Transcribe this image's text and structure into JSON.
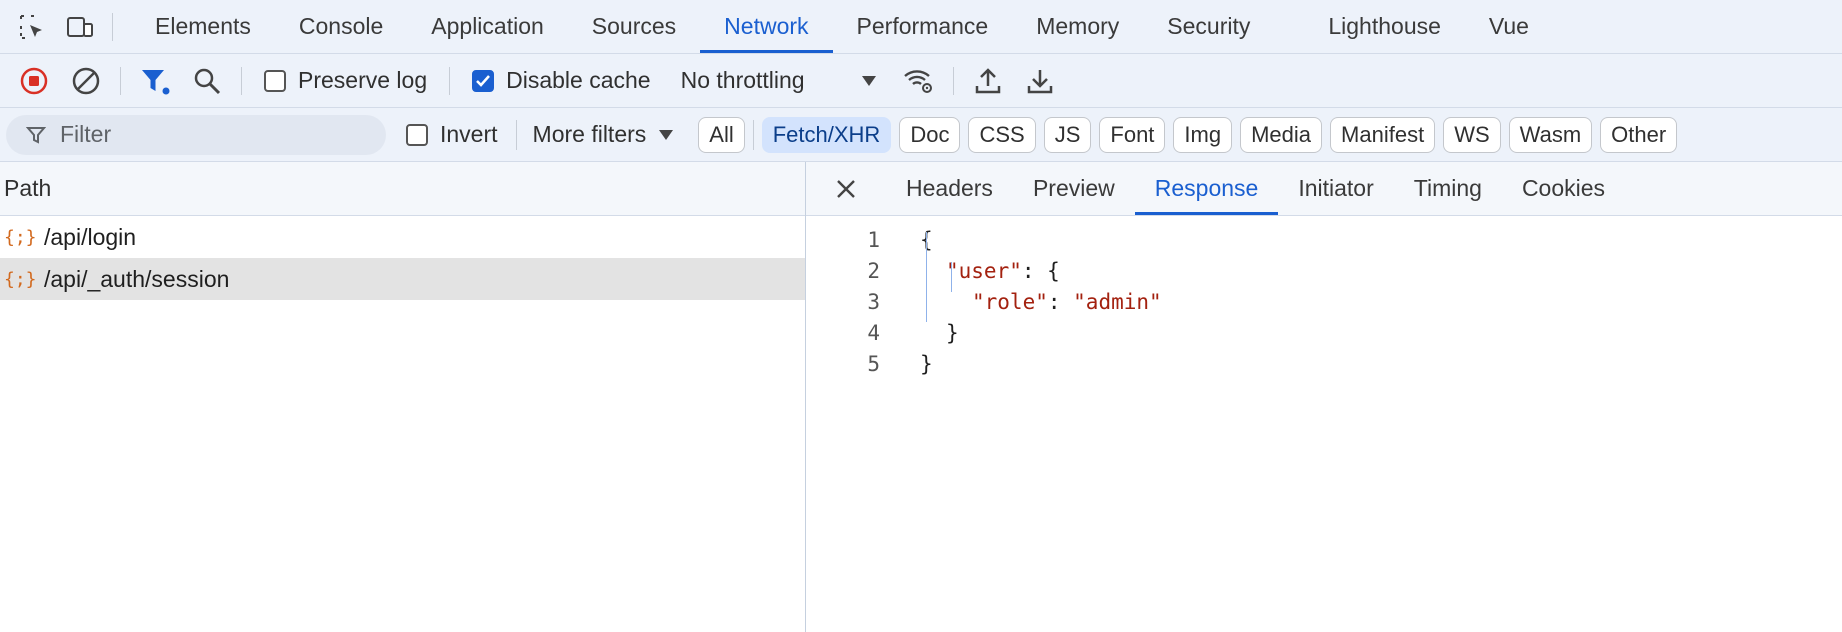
{
  "panel_tabs": [
    "Elements",
    "Console",
    "Application",
    "Sources",
    "Network",
    "Performance",
    "Memory",
    "Security",
    "Lighthouse",
    "Vue"
  ],
  "active_panel_tab": "Network",
  "toolbar": {
    "preserve_log_label": "Preserve log",
    "preserve_log_checked": false,
    "disable_cache_label": "Disable cache",
    "disable_cache_checked": true,
    "throttling": "No throttling"
  },
  "filterbar": {
    "filter_placeholder": "Filter",
    "invert_label": "Invert",
    "more_filters_label": "More filters",
    "types": [
      "All",
      "Fetch/XHR",
      "Doc",
      "CSS",
      "JS",
      "Font",
      "Img",
      "Media",
      "Manifest",
      "WS",
      "Wasm",
      "Other"
    ],
    "active_type": "Fetch/XHR"
  },
  "request_list": {
    "header": "Path",
    "rows": [
      {
        "path": "/api/login",
        "icon": "json-braces-icon",
        "selected": false
      },
      {
        "path": "/api/_auth/session",
        "icon": "json-braces-icon",
        "selected": true
      }
    ]
  },
  "detail": {
    "tabs": [
      "Headers",
      "Preview",
      "Response",
      "Initiator",
      "Timing",
      "Cookies"
    ],
    "active_tab": "Response",
    "response_lines": [
      {
        "n": "1",
        "text": "{"
      },
      {
        "n": "2",
        "text": "\"user\": {"
      },
      {
        "n": "3",
        "text": "\"role\": \"admin\""
      },
      {
        "n": "4",
        "text": "}"
      },
      {
        "n": "5",
        "text": "}"
      }
    ]
  },
  "colors": {
    "accent": "#1a5fd0",
    "record": "#d93025",
    "json_icon": "#d2691e",
    "json_string": "#a3210f"
  }
}
